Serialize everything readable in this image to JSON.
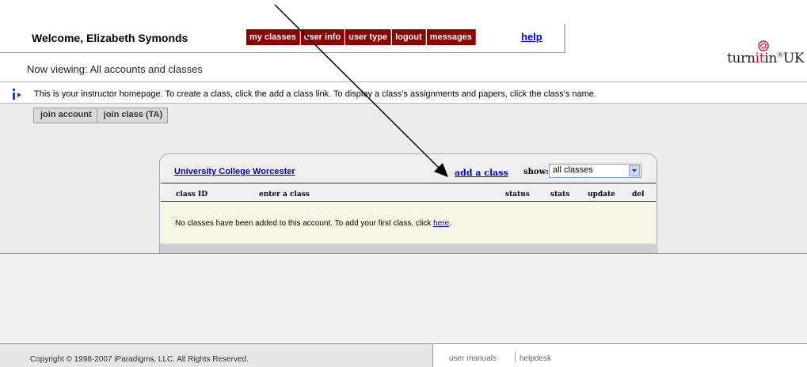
{
  "header": {
    "welcome": "Welcome, Elizabeth Symonds",
    "nav_tabs": [
      "my classes",
      "user info",
      "user type",
      "logout",
      "messages"
    ],
    "help": "help",
    "logo": {
      "pre": "turn",
      "mid": "it",
      "post": "in",
      "suffix": "UK"
    }
  },
  "viewing": "Now viewing: All accounts and classes",
  "info": {
    "text": "This is your instructor homepage. To create a class, click the add a class link. To display a class's assignments and papers, click the class's name."
  },
  "subtabs": [
    "join account",
    "join class (TA)"
  ],
  "panel": {
    "account_name": "University College Worcester",
    "add_class": "add a class",
    "show_label": "show:",
    "show_value": "all classes",
    "columns": [
      "class ID",
      "enter a class",
      "status",
      "stats",
      "update",
      "del"
    ],
    "empty_prefix": "No classes have been added to this account. To add your first class, click ",
    "empty_link": "here",
    "empty_suffix": "."
  },
  "footer": {
    "copyright": "Copyright © 1998-2007 iParadigms, LLC. All Rights Reserved.",
    "user_manuals": "user manuals",
    "helpdesk": "helpdesk"
  },
  "colors": {
    "nav_tab_bg": "#8b0000",
    "link": "#0000cc",
    "empty_row_bg": "#f7f6e4"
  }
}
